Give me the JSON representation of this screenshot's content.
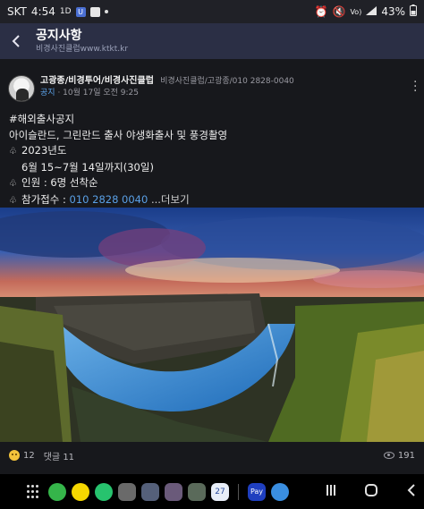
{
  "status_bar": {
    "carrier": "SKT",
    "time": "4:54",
    "battery": "43%",
    "icons": [
      "sync-icon",
      "talk-icon",
      "app-icon",
      "alarm-icon",
      "mute-icon",
      "volte-icon",
      "signal-icon"
    ]
  },
  "header": {
    "title": "공지사항",
    "subtitle": "비경사진클럽www.ktkt.kr",
    "back_icon": "back-arrow-icon"
  },
  "post": {
    "author": "고광종/비경투어/비경사진클럽",
    "affiliation": "비경사진클럽/고광종/010 2828-0040",
    "board": "공지",
    "date": "· 10월 17일 오전 9:25",
    "hashtag": "#해외출사공지",
    "title_line": "아이슬란드, 그린란드 출사 야생화출사 및 풍경촬영",
    "year_line": "2023년도",
    "period_line": "6월 15~7월 14일까지(30일)",
    "people_line": "인원 : 6명 선착순",
    "contact_label": "참가접수 :",
    "contact_phone": "010   2828 0040",
    "more": "...더보기"
  },
  "reactions": {
    "like_count": "12",
    "comments": "댓글 11",
    "views": "191"
  },
  "navbar": {
    "apps": [
      "phone-app-icon",
      "talk-app-icon",
      "bband-app-icon",
      "folder-app-icon",
      "folder2-app-icon",
      "folder3-app-icon",
      "folder4-app-icon",
      "calendar-app-icon",
      "pay-app-icon",
      "weather-app-icon"
    ],
    "calendar_day": "27",
    "pay_label": "Pay"
  },
  "colors": {
    "header_bg": "#2b2f45",
    "page_bg": "#17181c",
    "link": "#5aa0e6"
  }
}
